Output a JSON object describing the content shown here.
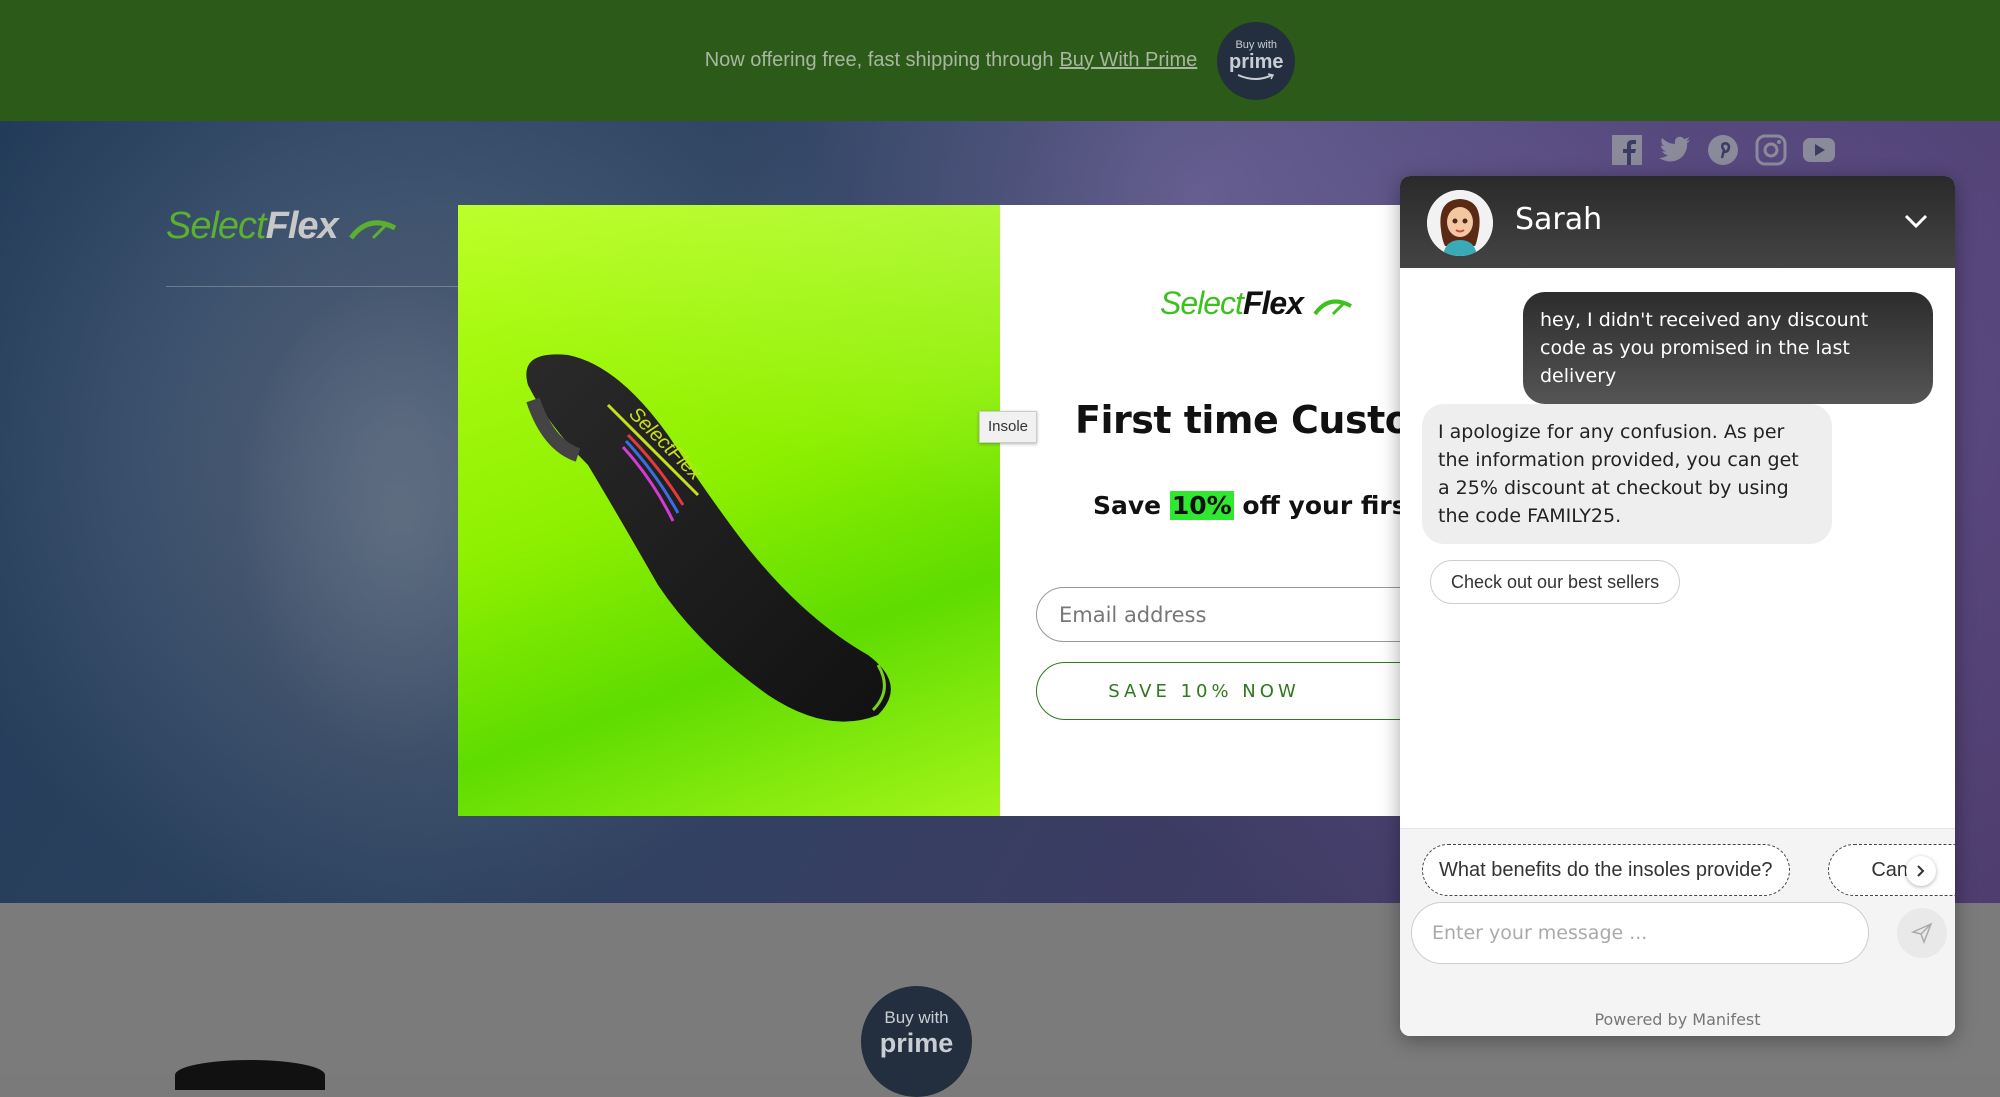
{
  "announcement": {
    "text": "Now offering free, fast shipping through",
    "link": "Buy With Prime",
    "badge_small": "Buy with",
    "badge_big": "prime"
  },
  "hero": {
    "logo_part1": "Select",
    "logo_part2": "Flex"
  },
  "social": {
    "icons": [
      "facebook-icon",
      "twitter-icon",
      "pinterest-icon",
      "instagram-icon",
      "youtube-icon"
    ]
  },
  "popup": {
    "logo_part1": "Select",
    "logo_part2": "Flex",
    "title": "First time Custom",
    "sub_before": "Save",
    "sub_highlight": "10%",
    "sub_after": "off your first or",
    "email_placeholder": "Email address",
    "cta": "SAVE 10% NOW",
    "image_tooltip": "Insole"
  },
  "chat": {
    "agent_name": "Sarah",
    "messages": [
      {
        "from": "user",
        "text": "hey, I didn't received any discount code as you promised in the last delivery"
      },
      {
        "from": "bot",
        "text": "I apologize for any confusion. As per the information provided, you can get a 25% discount at checkout by using the code FAMILY25."
      }
    ],
    "quick_reply": "Check out our best sellers",
    "suggestions": [
      "What benefits do the insoles provide?",
      "Can I c"
    ],
    "input_placeholder": "Enter your message ...",
    "powered_by": "Powered by Manifest"
  },
  "lower": {
    "badge_small": "Buy with",
    "badge_big": "prime"
  },
  "colors": {
    "topbar": "#2c5a18",
    "brand_green": "#3cc21e",
    "highlight": "#2fe82f",
    "cta_green": "#2d7a1a"
  }
}
